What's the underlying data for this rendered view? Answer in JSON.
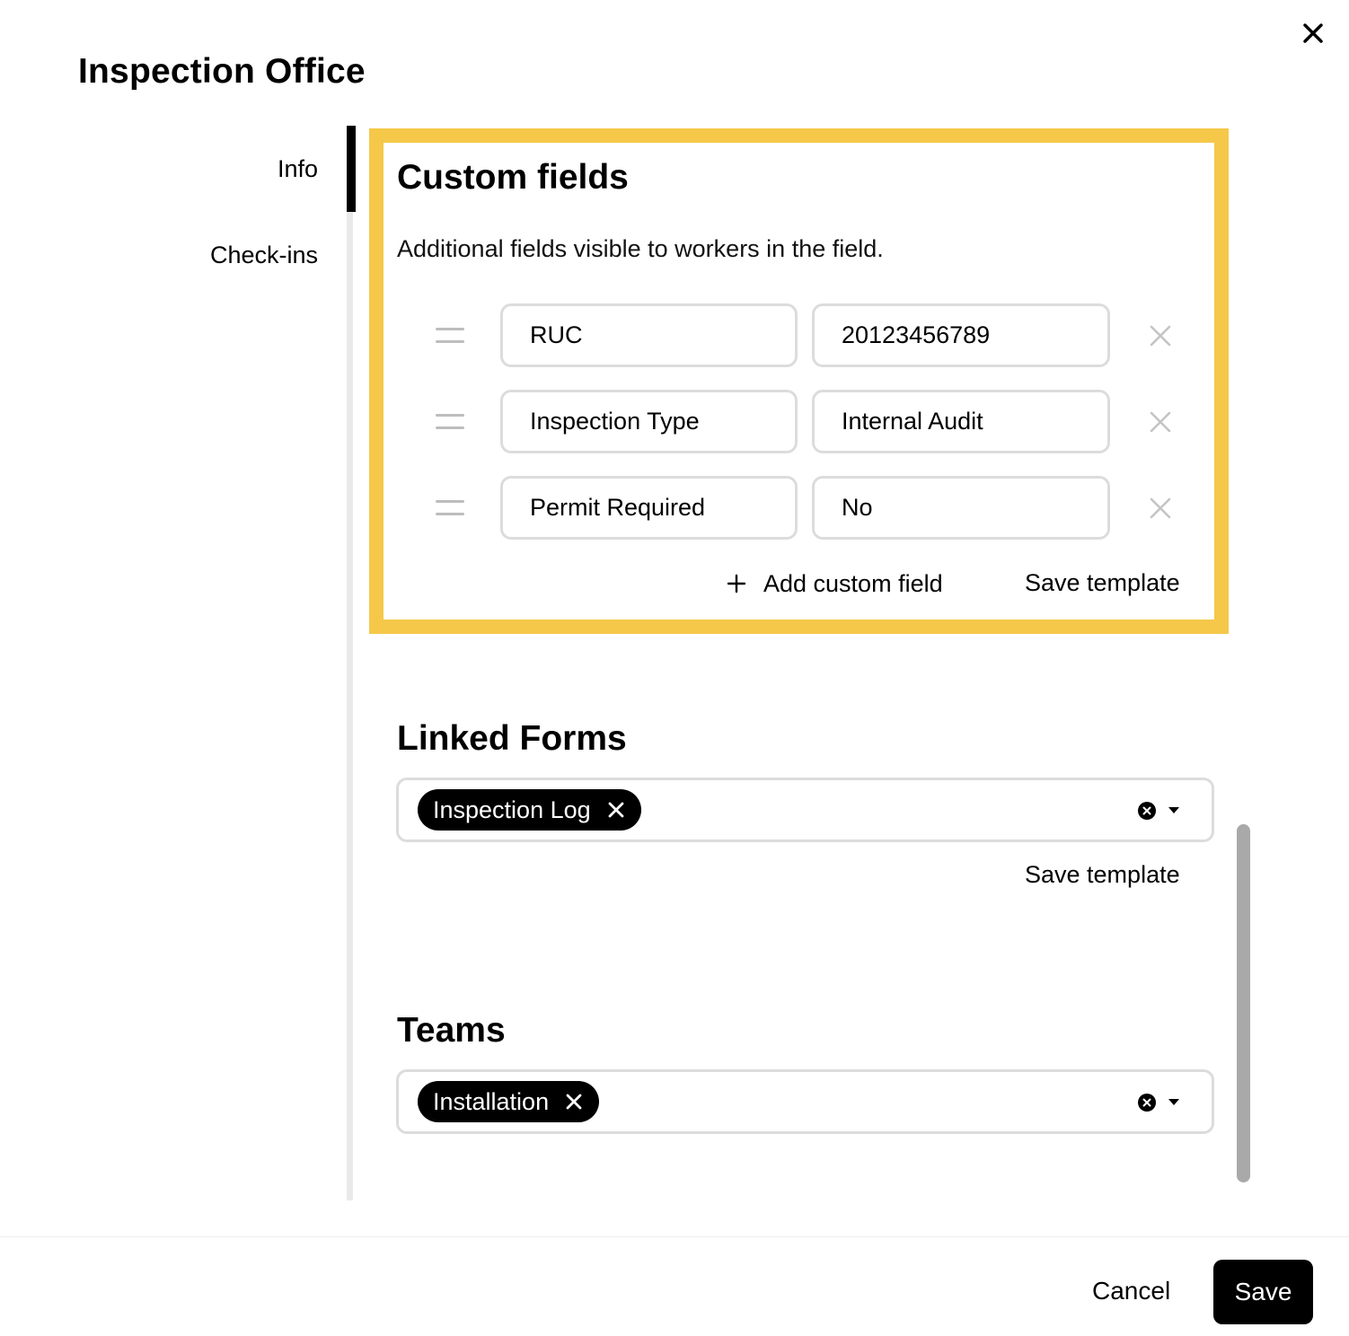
{
  "dialog": {
    "title": "Inspection Office",
    "close_icon": "close-icon"
  },
  "nav": {
    "items": [
      {
        "label": "Info",
        "active": true
      },
      {
        "label": "Check-ins",
        "active": false
      }
    ]
  },
  "custom_fields": {
    "title": "Custom fields",
    "description": "Additional fields visible to workers in the field.",
    "highlight_color": "#f5c84a",
    "rows": [
      {
        "name": "RUC",
        "value": "20123456789"
      },
      {
        "name": "Inspection Type",
        "value": "Internal Audit"
      },
      {
        "name": "Permit Required",
        "value": "No"
      }
    ],
    "add_label": "Add custom field",
    "save_template_label": "Save template"
  },
  "linked_forms": {
    "title": "Linked Forms",
    "selected": [
      "Inspection Log"
    ],
    "save_template_label": "Save template"
  },
  "teams": {
    "title": "Teams",
    "selected": [
      "Installation"
    ]
  },
  "footer": {
    "cancel_label": "Cancel",
    "save_label": "Save"
  }
}
